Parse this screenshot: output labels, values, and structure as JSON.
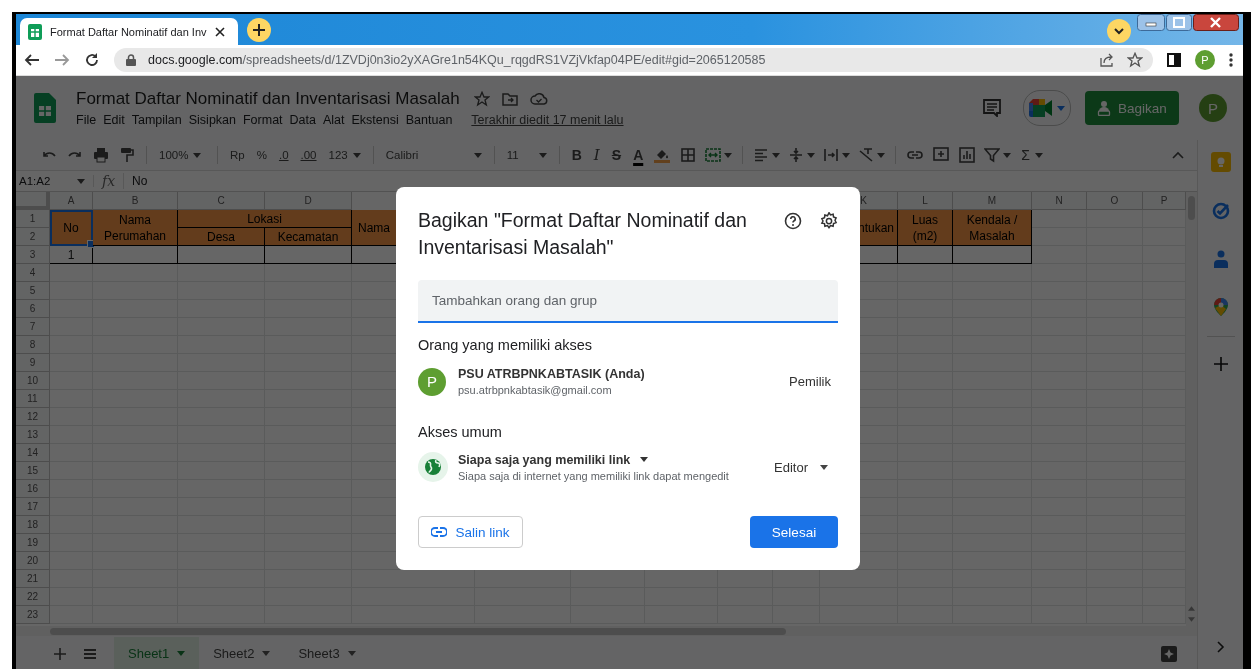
{
  "browser": {
    "tab_title": "Format Daftar Nominatif dan Inv",
    "url_host": "docs.google.com",
    "url_path": "/spreadsheets/d/1ZVDj0n3io2yXAGre1n54KQu_rqgdRS1VZjVkfap04PE/edit#gid=2065120585",
    "profile_initial": "P"
  },
  "doc": {
    "title": "Format Daftar Nominatif dan Inventarisasi Masalah",
    "menu": [
      "File",
      "Edit",
      "Tampilan",
      "Sisipkan",
      "Format",
      "Data",
      "Alat",
      "Ekstensi",
      "Bantuan"
    ],
    "last_edit": "Terakhir diedit 17 menit lalu",
    "share_label": "Bagikan",
    "avatar_initial": "P"
  },
  "toolbar": {
    "zoom": "100%",
    "currency": "Rp",
    "percent": "%",
    "decimal_less": ".0",
    "decimal_more": ".00",
    "number_format": "123",
    "font": "Calibri",
    "font_size": "11",
    "bold": "B",
    "italic": "I",
    "strike": "S",
    "text_color": "A",
    "functions": "Σ"
  },
  "formula_bar": {
    "cell_range": "A1:A2",
    "fx": "fx",
    "content": "No"
  },
  "grid": {
    "column_headers": [
      "A",
      "B",
      "C",
      "D",
      "K",
      "L",
      "M",
      "N",
      "O",
      "P"
    ],
    "row_numbers": [
      "1",
      "2",
      "3",
      "4",
      "5",
      "6",
      "7",
      "8",
      "9",
      "10",
      "11",
      "12",
      "13",
      "14",
      "15",
      "16",
      "17",
      "18",
      "19",
      "20",
      "21",
      "22",
      "23"
    ],
    "header_cells": [
      {
        "text": "No",
        "selected": true
      },
      {
        "text": "Nama Perumahan",
        "selected": false
      },
      {
        "text": "Lokasi",
        "selected": false
      },
      {
        "text": "Desa",
        "selected": false
      },
      {
        "text": "Kecamatan",
        "selected": false
      },
      {
        "text": "Nama",
        "selected": false
      },
      {
        "text": "ntukan",
        "selected": false
      },
      {
        "text": "Luas (m2)",
        "selected": false
      },
      {
        "text": "Kendala / Masalah",
        "selected": false
      }
    ],
    "data_cells": [
      "1"
    ]
  },
  "sheets": [
    {
      "label": "Sheet1",
      "selected": true
    },
    {
      "label": "Sheet2",
      "selected": false
    },
    {
      "label": "Sheet3",
      "selected": false
    }
  ],
  "dialog": {
    "title": "Bagikan \"Format Daftar Nominatif dan Inventarisasi Masalah\"",
    "add_placeholder": "Tambahkan orang dan grup",
    "access_heading": "Orang yang memiliki akses",
    "people": [
      {
        "initial": "P",
        "name": "PSU ATRBPNKABTASIK (Anda)",
        "email": "psu.atrbpnkabtasik@gmail.com",
        "role": "Pemilik"
      }
    ],
    "general_heading": "Akses umum",
    "general_access": {
      "scope": "Siapa saja yang memiliki link",
      "description": "Siapa saja di internet yang memiliki link dapat mengedit",
      "role": "Editor"
    },
    "copy_link": "Salin link",
    "done": "Selesai"
  }
}
